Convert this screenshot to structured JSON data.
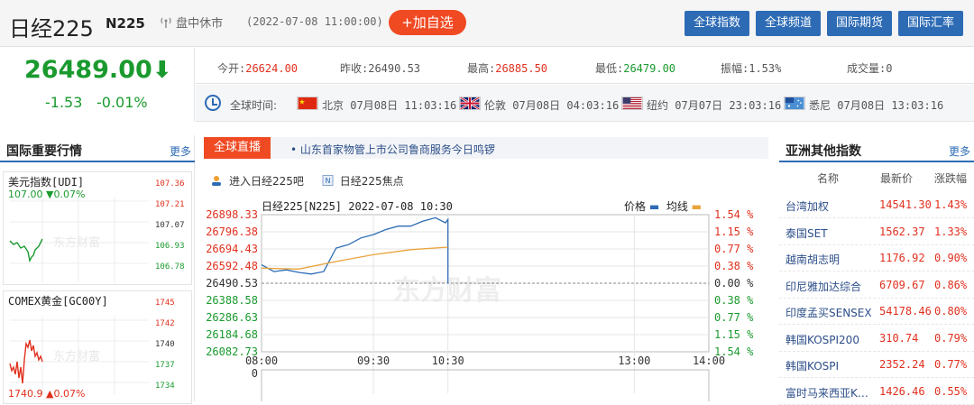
{
  "header": {
    "title": "日经225",
    "code": "N225",
    "market_status": "盘中休市",
    "datetime": "(2022-07-08 11:00:00)",
    "add_watchlist": "+加自选",
    "nav": [
      "全球指数",
      "全球频道",
      "国际期货",
      "国际汇率"
    ]
  },
  "quote": {
    "price": "26489.00",
    "arrow": "⬇",
    "change": "-1.53",
    "change_pct": "-0.01%",
    "open_label": "今开:",
    "open": "26624.00",
    "prev_label": "昨收:",
    "prev": "26490.53",
    "high_label": "最高:",
    "high": "26885.50",
    "low_label": "最低:",
    "low": "26479.00",
    "amp_label": "振幅:",
    "amp": "1.53%",
    "vol_label": "成交量:",
    "vol": "0"
  },
  "global_time": {
    "label": "全球时间:",
    "cities": [
      {
        "name": "北京",
        "date": "07月08日",
        "time": "11:03:16",
        "flag": "china-flag"
      },
      {
        "name": "伦敦",
        "date": "07月08日",
        "time": "04:03:16",
        "flag": "uk-flag"
      },
      {
        "name": "纽约",
        "date": "07月07日",
        "time": "23:03:16",
        "flag": "us-flag"
      },
      {
        "name": "悉尼",
        "date": "07月08日",
        "time": "13:03:16",
        "flag": "australia-flag"
      }
    ]
  },
  "left_panel": {
    "title": "国际重要行情",
    "more": "更多",
    "widgets": [
      {
        "name": "美元指数[UDI]",
        "value": "107.00",
        "change_arrow": "▼",
        "change_pct": "0.07%",
        "y_labels": [
          "107.36",
          "107.21",
          "107.07",
          "106.93",
          "106.78"
        ],
        "watermark": "东方财富"
      },
      {
        "name": "COMEX黄金[GC00Y]",
        "value": "1740.9",
        "change_arrow": "▲",
        "change_pct": "0.07%",
        "y_labels": [
          "1745",
          "1742",
          "1740",
          "1737",
          "1734"
        ],
        "watermark": "东方财富"
      }
    ]
  },
  "center": {
    "live_tag": "全球直播",
    "live_text": "• 山东首家物管上市公司鲁商服务今日鸣锣",
    "links": [
      "进入日经225吧",
      "日经225焦点"
    ],
    "watermark": "东方财富"
  },
  "chart_data": {
    "type": "line",
    "title": "日经225[N225] 2022-07-08 10:30",
    "legend": [
      "价格",
      "均线"
    ],
    "x_ticks": [
      "08:00",
      "09:30",
      "10:30",
      "13:00",
      "14:00"
    ],
    "y_ticks_left": [
      "26898.33",
      "26796.38",
      "26694.43",
      "26592.48",
      "26490.53",
      "26388.58",
      "26286.63",
      "26184.68",
      "26082.73"
    ],
    "y_ticks_right": [
      "1.54 %",
      "1.15 %",
      "0.77 %",
      "0.38 %",
      "0.00 %",
      "0.38 %",
      "0.77 %",
      "1.15 %",
      "1.54 %"
    ],
    "volume_label": "0",
    "ylim": [
      26082.73,
      26898.33
    ],
    "prev_close": 26490.53,
    "colors": {
      "price": "#2d6bb5",
      "avg": "#e8a33a",
      "up": "#e0301e",
      "down": "#1a9a2e"
    },
    "series": [
      {
        "name": "价格",
        "x": [
          "08:00",
          "08:10",
          "08:20",
          "08:30",
          "08:40",
          "08:50",
          "09:00",
          "09:10",
          "09:20",
          "09:30",
          "09:40",
          "09:50",
          "10:00",
          "10:10",
          "10:20",
          "10:28",
          "10:30",
          "10:30"
        ],
        "values": [
          26600,
          26560,
          26570,
          26555,
          26545,
          26560,
          26700,
          26720,
          26760,
          26780,
          26810,
          26830,
          26830,
          26860,
          26880,
          26850,
          26870,
          26489
        ]
      },
      {
        "name": "均线",
        "x": [
          "08:00",
          "08:30",
          "09:00",
          "09:30",
          "10:00",
          "10:30"
        ],
        "values": [
          26580,
          26575,
          26620,
          26660,
          26690,
          26705
        ]
      }
    ]
  },
  "right_panel": {
    "title": "亚洲其他指数",
    "more": "更多",
    "columns": [
      "名称",
      "最新价",
      "涨跌幅"
    ],
    "rows": [
      {
        "name": "台湾加权",
        "price": "14541.30",
        "pct": "1.43%"
      },
      {
        "name": "泰国SET",
        "price": "1562.37",
        "pct": "1.33%"
      },
      {
        "name": "越南胡志明",
        "price": "1176.92",
        "pct": "0.90%"
      },
      {
        "name": "印尼雅加达综合",
        "price": "6709.67",
        "pct": "0.86%"
      },
      {
        "name": "印度孟买SENSEX",
        "price": "54178.46",
        "pct": "0.80%"
      },
      {
        "name": "韩国KOSPI200",
        "price": "310.74",
        "pct": "0.79%"
      },
      {
        "name": "韩国KOSPI",
        "price": "2352.24",
        "pct": "0.77%"
      },
      {
        "name": "富时马来西亚K…",
        "price": "1426.46",
        "pct": "0.55%"
      }
    ]
  }
}
